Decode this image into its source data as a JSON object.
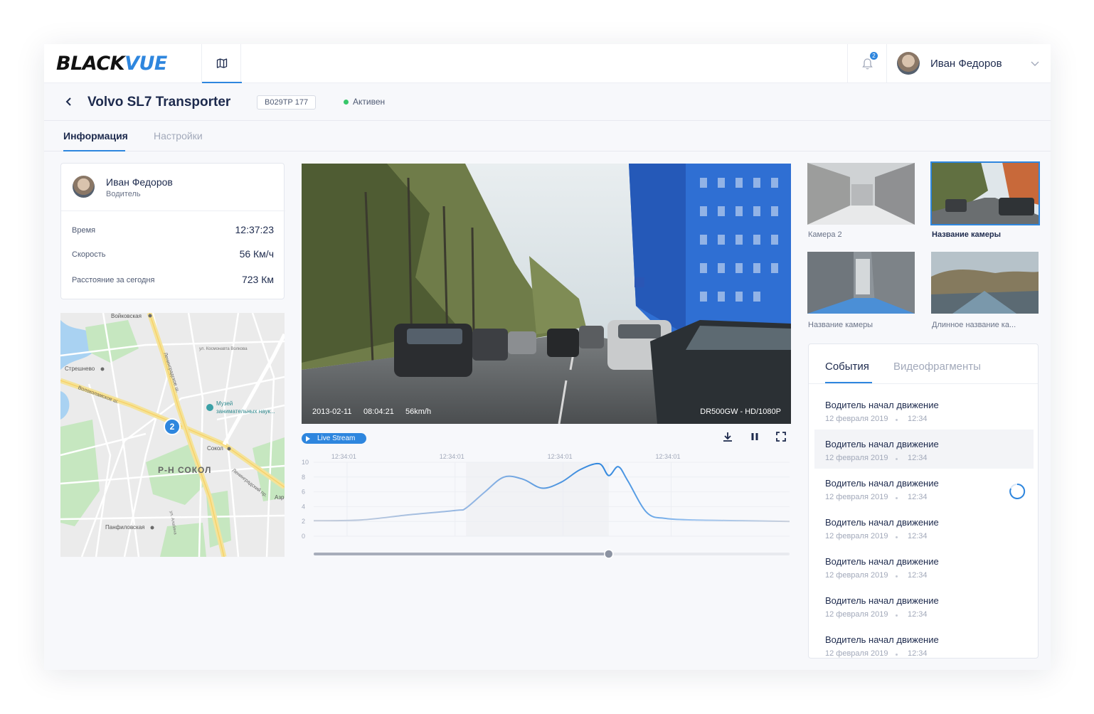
{
  "brand": {
    "part1": "BLACK",
    "part2": "VUE"
  },
  "notifications": {
    "count": "2"
  },
  "user": {
    "name": "Иван Федоров"
  },
  "vehicle": {
    "title": "Volvo SL7 Transporter",
    "plate": "В029ТР 177",
    "status": "Активен",
    "status_color": "#37c76a"
  },
  "tabs": [
    {
      "label": "Информация",
      "active": true
    },
    {
      "label": "Настройки",
      "active": false
    }
  ],
  "driver": {
    "name": "Иван Федоров",
    "role": "Водитель",
    "stats": [
      {
        "label": "Время",
        "value": "12:37:23"
      },
      {
        "label": "Скорость",
        "value": "56 Км/ч"
      },
      {
        "label": "Расстояние за сегодня",
        "value": "723 Км"
      }
    ]
  },
  "map": {
    "labels": [
      "Войковская",
      "Стрешнево",
      "Музей",
      "занимательных наук...",
      "Сокол",
      "Р-Н СОКОЛ",
      "Панфиловская",
      "Ленинградский пр.",
      "Ленинградское ш.",
      "Волоколамское ш.",
      "ул. Космонавта Волкова",
      "ул. Алабяна",
      "Азр"
    ],
    "cluster": "2"
  },
  "video": {
    "date": "2013-02-11",
    "time": "08:04:21",
    "speed": "56km/h",
    "model": "DR500GW - HD/1080P"
  },
  "controls": {
    "live_label": "Live Stream",
    "icons": [
      "download-icon",
      "pause-icon",
      "fullscreen-icon"
    ]
  },
  "chart_data": {
    "type": "line",
    "x_ticks": [
      "12:34:01",
      "12:34:01",
      "12:34:01",
      "12:34:01"
    ],
    "y_ticks": [
      "10",
      "8",
      "6",
      "4",
      "2",
      "0"
    ],
    "ylim": [
      0,
      10
    ],
    "x": [
      0,
      0.1,
      0.2,
      0.3,
      0.32,
      0.36,
      0.4,
      0.44,
      0.48,
      0.52,
      0.56,
      0.6,
      0.62,
      0.64,
      0.66,
      0.7,
      0.74,
      0.8,
      0.9,
      1.0
    ],
    "values": [
      2.1,
      2.2,
      2.9,
      3.5,
      3.8,
      6.0,
      8.0,
      7.7,
      6.5,
      7.3,
      9.0,
      9.8,
      8.2,
      9.4,
      7.5,
      3.2,
      2.4,
      2.2,
      2.1,
      2.0
    ],
    "playhead": 0.62,
    "color": "#2e86de"
  },
  "cameras": [
    {
      "label": "Камера 2",
      "selected": false
    },
    {
      "label": "Название камеры",
      "selected": true
    },
    {
      "label": "Название камеры",
      "selected": false
    },
    {
      "label": "Длинное название ка...",
      "selected": false
    }
  ],
  "events": {
    "tabs": [
      "События",
      "Видеофрагменты"
    ],
    "items": [
      {
        "title": "Водитель начал движение",
        "date": "12 февраля 2019",
        "time": "12:34"
      },
      {
        "title": "Водитель начал движение",
        "date": "12 февраля 2019",
        "time": "12:34"
      },
      {
        "title": "Водитель начал движение",
        "date": "12 февраля 2019",
        "time": "12:34"
      },
      {
        "title": "Водитель начал движение",
        "date": "12 февраля 2019",
        "time": "12:34"
      },
      {
        "title": "Водитель начал движение",
        "date": "12 февраля 2019",
        "time": "12:34"
      },
      {
        "title": "Водитель начал движение",
        "date": "12 февраля 2019",
        "time": "12:34"
      },
      {
        "title": "Водитель начал движение",
        "date": "12 февраля 2019",
        "time": "12:34"
      }
    ]
  }
}
